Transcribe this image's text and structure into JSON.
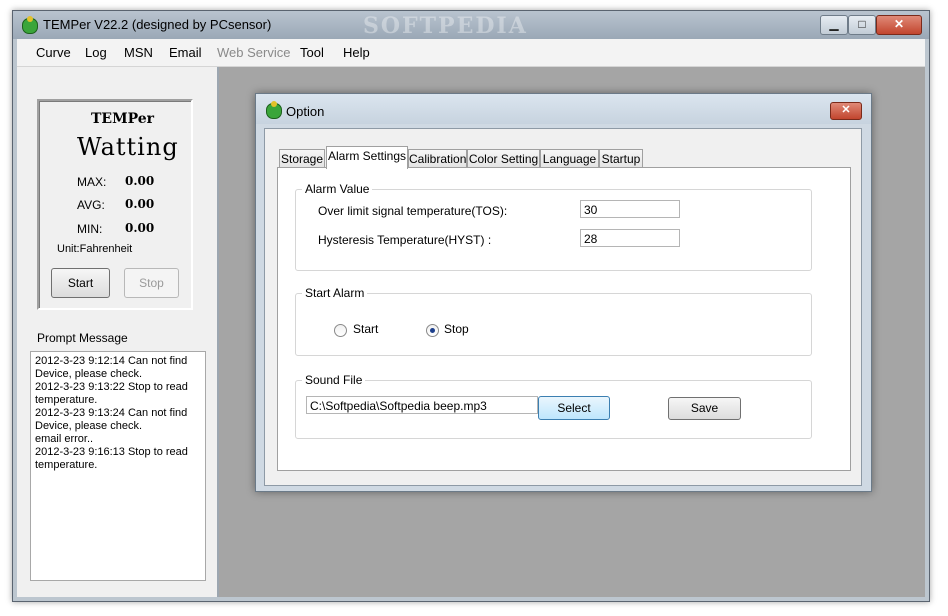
{
  "window": {
    "title": "TEMPer V22.2 (designed by PCsensor)",
    "watermark": "SOFTPEDIA",
    "minimize": "▁",
    "maximize": "□",
    "close": "✕"
  },
  "menu": [
    "Curve",
    "Log",
    "MSN",
    "Email",
    "Web Service",
    "Tool",
    "Help"
  ],
  "status_panel": {
    "brand": "TEMPer",
    "state": "Watting",
    "max_label": "MAX:",
    "max_value": "0.00",
    "avg_label": "AVG:",
    "avg_value": "0.00",
    "min_label": "MIN:",
    "min_value": "0.00",
    "unit": "Unit:Fahrenheit",
    "start_button": "Start",
    "stop_button": "Stop"
  },
  "prompt": {
    "title": "Prompt Message",
    "lines": [
      "2012-3-23 9:12:14 Can not find",
      "Device, please check.",
      "2012-3-23 9:13:22 Stop to read",
      "temperature.",
      "2012-3-23 9:13:24 Can not find",
      "Device, please check.",
      "email error..",
      "2012-3-23 9:16:13 Stop to read",
      "temperature."
    ]
  },
  "dialog": {
    "title": "Option",
    "close": "✕",
    "tabs": [
      "Storage",
      "Alarm Settings",
      "Calibration",
      "Color Setting",
      "Language",
      "Startup"
    ],
    "active_tab": "Alarm Settings",
    "alarm_value": {
      "group_title": "Alarm Value",
      "tos_label": "Over limit signal temperature(TOS):",
      "tos_value": "30",
      "hyst_label": "Hysteresis Temperature(HYST) :",
      "hyst_value": "28"
    },
    "start_alarm": {
      "group_title": "Start Alarm",
      "start_label": "Start",
      "stop_label": "Stop",
      "selected": "Stop"
    },
    "sound_file": {
      "group_title": "Sound File",
      "path": "C:\\Softpedia\\Softpedia beep.mp3",
      "select_button": "Select",
      "save_button": "Save"
    }
  },
  "colors": {
    "app_bg": "#f0f0f0",
    "workspace_gray": "#a5a5a5",
    "close_red": "#c2452e",
    "radio_dot": "#1d3f8c"
  }
}
